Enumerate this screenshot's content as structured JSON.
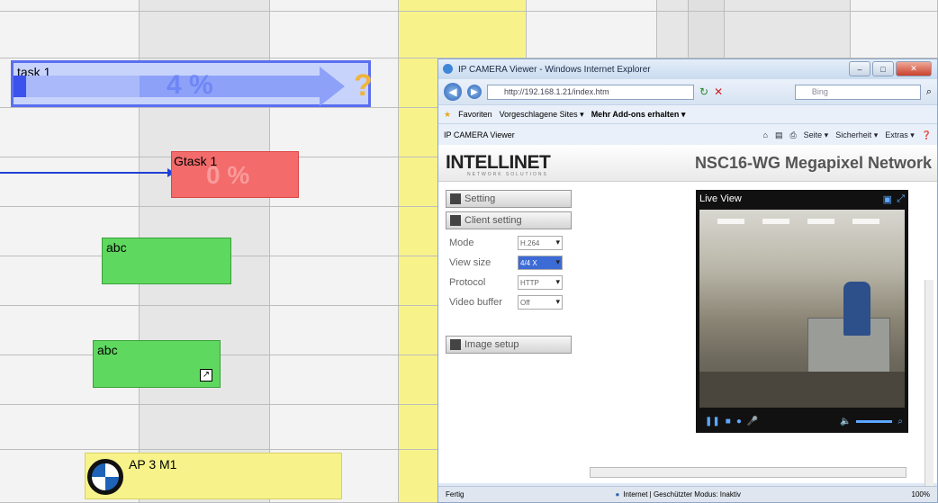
{
  "gantt": {
    "tasks": [
      {
        "label": "task 1",
        "percent": "4 %",
        "badge": "?"
      },
      {
        "label": "Gtask 1",
        "percent": "0 %"
      },
      {
        "label": "abc"
      },
      {
        "label": "abc",
        "corner_icon": "shortcut-arrow-icon"
      },
      {
        "label": "AP 3 M1",
        "logo": "bmw-logo"
      }
    ],
    "colors": {
      "task_blue": "#6f8dfc",
      "task_red": "#f36b6b",
      "task_green": "#5fd85f",
      "milestone_yellow": "#f7f38a",
      "connector": "#1f3fd6"
    }
  },
  "browser": {
    "window_title": "IP CAMERA Viewer - Windows Internet Explorer",
    "address": "http://192.168.1.21/index.htm",
    "search_placeholder": "Bing",
    "favorites": [
      "Favoriten",
      "Vorgeschlagene Sites ▾",
      "Mehr Add-ons erhalten ▾"
    ],
    "tab_title": "IP CAMERA Viewer",
    "tools": [
      "Seite ▾",
      "Sicherheit ▾",
      "Extras ▾"
    ],
    "status_left": "Fertig",
    "status_middle": "Internet | Geschützter Modus: Inaktiv",
    "zoom": "100%"
  },
  "camera_page": {
    "brand": "INTELLINET",
    "brand_sub": "NETWORK SOLUTIONS",
    "model": "NSC16-WG Megapixel Network",
    "setting_button": "Setting",
    "client_setting_button": "Client setting",
    "settings": [
      {
        "label": "Mode",
        "value": "H.264"
      },
      {
        "label": "View size",
        "value": "4/4 X"
      },
      {
        "label": "Protocol",
        "value": "HTTP"
      },
      {
        "label": "Video buffer",
        "value": "Off"
      }
    ],
    "image_setup_button": "Image setup",
    "live_view_title": "Live View"
  }
}
